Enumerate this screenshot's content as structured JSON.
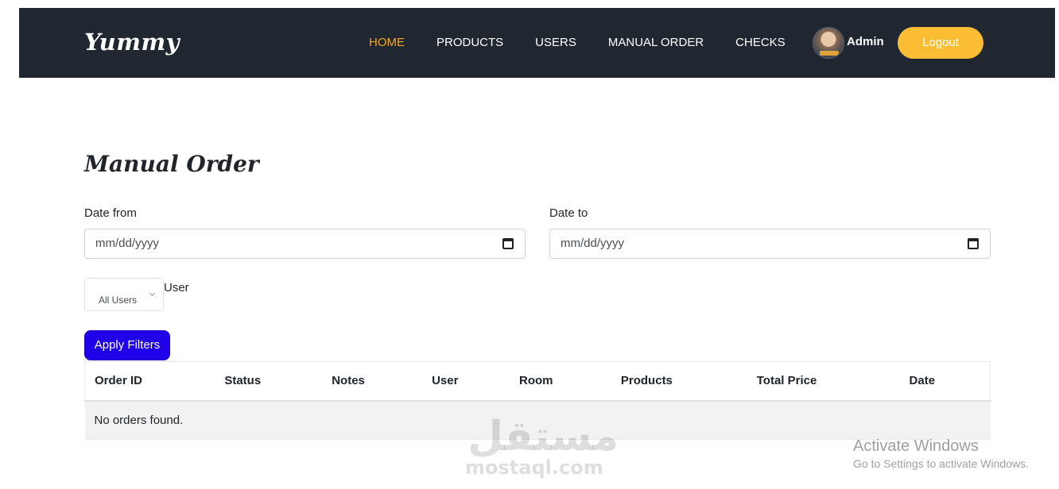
{
  "navbar": {
    "brand": "Yummy",
    "links": [
      "HOME",
      "PRODUCTS",
      "USERS",
      "MANUAL ORDER",
      "CHECKS"
    ],
    "active_link": "HOME",
    "active_color": "#f5a623",
    "background": "#212731",
    "admin_name": "Admin",
    "logout_label": "Logout",
    "logout_color": "#fbbd34"
  },
  "main": {
    "title": "Manual Order",
    "date_from": {
      "label": "Date from",
      "placeholder": "mm/dd/yyyy"
    },
    "date_to": {
      "label": "Date to",
      "placeholder": "mm/dd/yyyy"
    },
    "user_filter": {
      "selected": "All Users",
      "label": "User"
    },
    "apply_label": "Apply Filters",
    "apply_color": "#2000e8"
  },
  "table": {
    "columns": [
      "Order ID",
      "Status",
      "Notes",
      "User",
      "Room",
      "Products",
      "Total Price",
      "Date"
    ],
    "empty_message": "No orders found."
  },
  "watermark": {
    "arabic": "مستقل",
    "latin": "mostaql.com"
  },
  "windows_notice": {
    "title": "Activate Windows",
    "subtitle": "Go to Settings to activate Windows."
  }
}
